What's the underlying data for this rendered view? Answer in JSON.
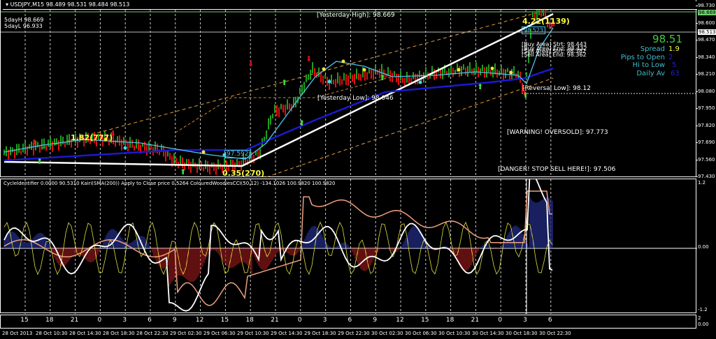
{
  "header": {
    "symbol_line": "USDJPY,M15  98.489 98.531 98.484 98.513",
    "five_day_high": "5dayH 98.669",
    "five_day_low": "5dayL 96.933"
  },
  "levels": {
    "yesterday_high": "[Yesterday High]: 98.669",
    "yesterday_low": "[Yesterday Low]: 98.046",
    "reversal_low": "[Reversal Low]: 98.12",
    "warning": "[WARNING! OVERSOLD]: 97.773",
    "danger": "[DANGER! STOP SELL HERE!]: 97.506",
    "buy_area_start": "[Buy Area] Strt: 98.443",
    "buy_area_end": "[Buy Area] End: 98.432",
    "sell_area_start": "[Sell Area] Strt: 98.382",
    "sell_area_end": "[Sell Area] End: 98.362",
    "swing_high": "4.22(1139)",
    "swing_low": "0.35(270)",
    "swing_mid": "1.82(777)",
    "box_price": "97.592",
    "box_price_top": "98.523"
  },
  "info_panel": {
    "price": "98.51",
    "spread_label": "Spread",
    "spread": "1.9",
    "pips_label": "Pips to Open",
    "pips": "2",
    "hilo_label": "Hi to Low",
    "hilo": "5",
    "daily_label": "Daily Av",
    "daily": "63"
  },
  "price_axis": [
    "98.730",
    "98.600",
    "98.470",
    "98.340",
    "98.210",
    "98.080",
    "97.950",
    "97.820",
    "97.690",
    "97.560",
    "97.430"
  ],
  "price_tags": {
    "yesterday_high": "98.669",
    "current": "98.513"
  },
  "indicator": {
    "title": "CycleIdentifier 0.0000 90.5310  Kairi(SMA(200)) Apply to Close price 0.5264  ColouredWoodiesCCI(50,12) -134.1026 100.9820 100.9820",
    "axis": [
      "1.2",
      "0.00",
      "-1.2"
    ]
  },
  "bottom_axis": {
    "right": "2",
    "right2": "0.00"
  },
  "hours": [
    "15",
    "18",
    "21",
    "0",
    "3",
    "6",
    "9",
    "12",
    "15",
    "18",
    "21",
    "0",
    "3",
    "6",
    "9",
    "12",
    "15",
    "18",
    "21",
    "0",
    "3",
    "6"
  ],
  "dates": [
    "28 Oct 2013",
    "28 Oct 10:30",
    "28 Oct 14:30",
    "28 Oct 18:30",
    "28 Oct 22:30",
    "29 Oct 02:30",
    "29 Oct 06:30",
    "29 Oct 10:30",
    "29 Oct 14:30",
    "29 Oct 18:30",
    "29 Oct 22:30",
    "30 Oct 02:30",
    "30 Oct 06:30",
    "30 Oct 10:30",
    "30 Oct 14:30",
    "30 Oct 18:30",
    "30 Oct 22:30"
  ],
  "colors": {
    "bull": "#1f9e1f",
    "bear": "#e01010",
    "ma": "#1a1ad0",
    "fast": "#4fc4e8",
    "accent": "#ffff40",
    "green_level": "#6fcf6f",
    "info": "#3fbfcf"
  }
}
